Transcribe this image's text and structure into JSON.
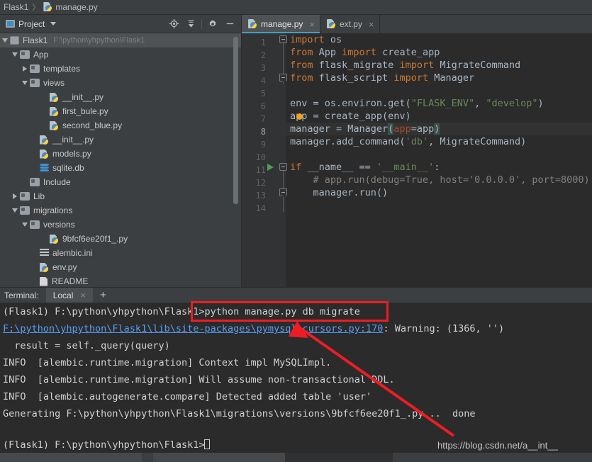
{
  "breadcrumb": {
    "items": [
      "Flask1",
      "manage.py"
    ],
    "separator": "〉"
  },
  "project_toolbar": {
    "label": "Project",
    "icons": [
      "locate-icon",
      "collapse-all-icon",
      "settings-gear-icon",
      "hide-icon"
    ]
  },
  "project_tree": [
    {
      "indent": 0,
      "twisty": "down",
      "icon": "module-icon",
      "label": "Flask1",
      "path": "F:\\python\\yhpython\\Flask1",
      "selected": true
    },
    {
      "indent": 1,
      "twisty": "down",
      "icon": "folder-icon",
      "label": "App",
      "path": ""
    },
    {
      "indent": 2,
      "twisty": "right",
      "icon": "folder-icon",
      "label": "templates",
      "path": ""
    },
    {
      "indent": 2,
      "twisty": "down",
      "icon": "folder-icon",
      "label": "views",
      "path": ""
    },
    {
      "indent": 4,
      "twisty": "none",
      "icon": "python-file-icon",
      "label": "__init__.py",
      "path": ""
    },
    {
      "indent": 4,
      "twisty": "none",
      "icon": "python-file-icon",
      "label": "first_bule.py",
      "path": ""
    },
    {
      "indent": 4,
      "twisty": "none",
      "icon": "python-file-icon",
      "label": "second_blue.py",
      "path": ""
    },
    {
      "indent": 3,
      "twisty": "none",
      "icon": "python-file-icon",
      "label": "__init__.py",
      "path": ""
    },
    {
      "indent": 3,
      "twisty": "none",
      "icon": "python-file-icon",
      "label": "models.py",
      "path": ""
    },
    {
      "indent": 3,
      "twisty": "none",
      "icon": "database-icon",
      "label": "sqlite.db",
      "path": ""
    },
    {
      "indent": 2,
      "twisty": "none",
      "icon": "folder-icon",
      "label": "Include",
      "path": ""
    },
    {
      "indent": 1,
      "twisty": "right",
      "icon": "folder-icon",
      "label": "Lib",
      "path": ""
    },
    {
      "indent": 1,
      "twisty": "down",
      "icon": "folder-icon",
      "label": "migrations",
      "path": ""
    },
    {
      "indent": 2,
      "twisty": "down",
      "icon": "folder-icon",
      "label": "versions",
      "path": ""
    },
    {
      "indent": 4,
      "twisty": "none",
      "icon": "python-file-icon",
      "label": "9bfcf6ee20f1_.py",
      "path": ""
    },
    {
      "indent": 3,
      "twisty": "none",
      "icon": "ini-file-icon",
      "label": "alembic.ini",
      "path": ""
    },
    {
      "indent": 3,
      "twisty": "none",
      "icon": "python-file-icon",
      "label": "env.py",
      "path": ""
    },
    {
      "indent": 3,
      "twisty": "none",
      "icon": "text-file-icon",
      "label": "README",
      "path": ""
    }
  ],
  "editor_tabs": [
    {
      "label": "manage.py",
      "icon": "python-file-icon",
      "active": true,
      "close": "×"
    },
    {
      "label": "ext.py",
      "icon": "python-file-icon",
      "active": false,
      "close": "×"
    }
  ],
  "editor": {
    "current_line": 8,
    "run_marker_line": 11,
    "line_numbers": [
      "1",
      "2",
      "3",
      "4",
      "5",
      "6",
      "7",
      "8",
      "9",
      "10",
      "11",
      "12",
      "13",
      "14"
    ],
    "code_lines": [
      {
        "n": 1,
        "text": "import os"
      },
      {
        "n": 2,
        "text": "from App import create_app"
      },
      {
        "n": 3,
        "text": "from flask_migrate import MigrateCommand"
      },
      {
        "n": 4,
        "text": "from flask_script import Manager"
      },
      {
        "n": 5,
        "text": ""
      },
      {
        "n": 6,
        "text": "env = os.environ.get(\"FLASK_ENV\", \"develop\")"
      },
      {
        "n": 7,
        "text": "app = create_app(env)"
      },
      {
        "n": 8,
        "text": "manager = Manager(app=app)"
      },
      {
        "n": 9,
        "text": "manager.add_command('db', MigrateCommand)"
      },
      {
        "n": 10,
        "text": ""
      },
      {
        "n": 11,
        "text": "if __name__ == '__main__':"
      },
      {
        "n": 12,
        "text": "    # app.run(debug=True, host='0.0.0.0', port=8000)"
      },
      {
        "n": 13,
        "text": "    manager.run()"
      },
      {
        "n": 14,
        "text": ""
      }
    ]
  },
  "terminal": {
    "title": "Terminal:",
    "tab": "Local",
    "tab_close": "×",
    "add": "+",
    "lines": [
      {
        "id": "cmd",
        "prompt": "(Flask1) F:\\python\\yhpython\\Flask1>",
        "command": "python manage.py db migrate"
      },
      {
        "id": "warn",
        "link": "F:\\python\\yhpython\\Flask1\\lib\\site-packages\\pymysql\\cursors.py:170",
        "rest": ": Warning: (1366, '')"
      },
      {
        "id": "res",
        "text": "  result = self._query(query)"
      },
      {
        "id": "info1",
        "text": "INFO  [alembic.runtime.migration] Context impl MySQLImpl."
      },
      {
        "id": "info2",
        "text": "INFO  [alembic.runtime.migration] Will assume non-transactional DDL."
      },
      {
        "id": "info3",
        "text": "INFO  [alembic.autogenerate.compare] Detected added table 'user'"
      },
      {
        "id": "gen",
        "text": "Generating F:\\python\\yhpython\\Flask1\\migrations\\versions\\9bfcf6ee20f1_.py ..",
        "suffix": "  done"
      },
      {
        "id": "blank",
        "text": ""
      },
      {
        "id": "last",
        "prompt": "(Flask1) F:\\python\\yhpython\\Flask1>",
        "command": ""
      }
    ]
  },
  "annotations": {
    "watermark": "https://blog.csdn.net/a__int__",
    "highlight_color": "#ee1c24"
  }
}
